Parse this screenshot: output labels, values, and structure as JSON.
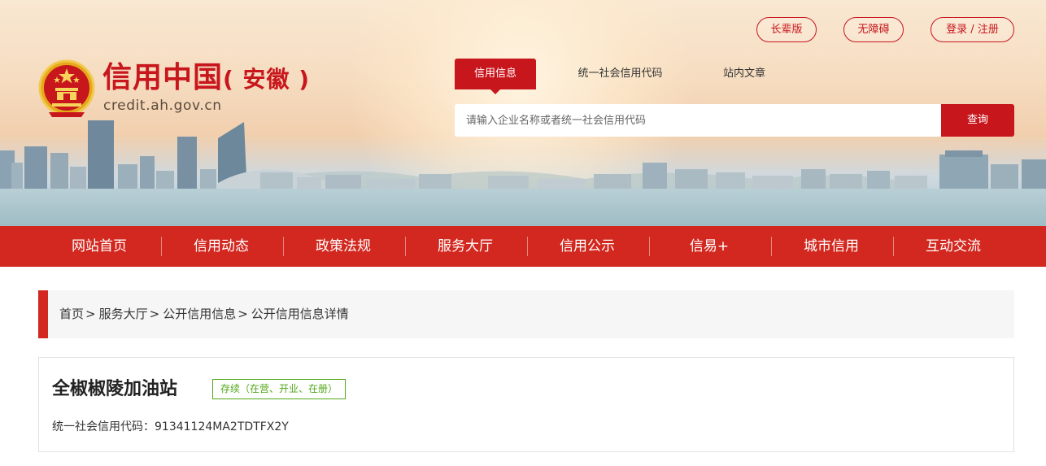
{
  "header": {
    "logo_title": "信用中国",
    "logo_region": "( 安徽 )",
    "logo_url": "credit.ah.gov.cn",
    "top_buttons": {
      "elder": "长辈版",
      "accessibility": "无障碍",
      "login": "登录 / 注册"
    },
    "search": {
      "tabs": [
        "信用信息",
        "统一社会信用代码",
        "站内文章"
      ],
      "active_tab": 0,
      "placeholder": "请输入企业名称或者统一社会信用代码",
      "button": "查询"
    }
  },
  "nav": {
    "items": [
      "网站首页",
      "信用动态",
      "政策法规",
      "服务大厅",
      "信用公示",
      "信易+",
      "城市信用",
      "互动交流"
    ]
  },
  "breadcrumb": {
    "items": [
      "首页",
      "服务大厅",
      "公开信用信息",
      "公开信用信息详情"
    ],
    "separator": ">"
  },
  "company": {
    "name": "全椒椒陵加油站",
    "status": "存续（在营、开业、在册）",
    "code_label": "统一社会信用代码：",
    "code_value": "91341124MA2TDTFX2Y"
  },
  "colors": {
    "brand_red": "#c8161d",
    "nav_red": "#d2281f",
    "status_green": "#52a71a"
  },
  "icons": {
    "emblem": "national-emblem-icon"
  }
}
